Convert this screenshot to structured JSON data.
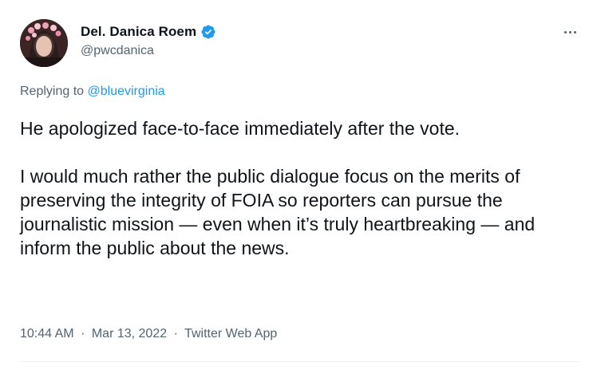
{
  "author": {
    "display_name": "Del. Danica Roem",
    "handle": "@pwcdanica",
    "verified": true,
    "verified_icon": "verified-badge-icon",
    "avatar_icon": "profile-photo"
  },
  "reply": {
    "prefix": "Replying to",
    "target": "@bluevirginia"
  },
  "tweet": {
    "paragraph_1": "He apologized face-to-face immediately after the vote.",
    "paragraph_2": "I would much rather the public dialogue focus on the merits of preserving the integrity of FOIA so reporters can pursue the journalistic mission — even when it’s truly heartbreaking — and inform the public about the news."
  },
  "meta": {
    "time": "10:44 AM",
    "date": "Mar 13, 2022",
    "source": "Twitter Web App",
    "separator": "·"
  },
  "colors": {
    "accent": "#1d9bf0",
    "text": "#0f1419",
    "secondary": "#536471"
  }
}
